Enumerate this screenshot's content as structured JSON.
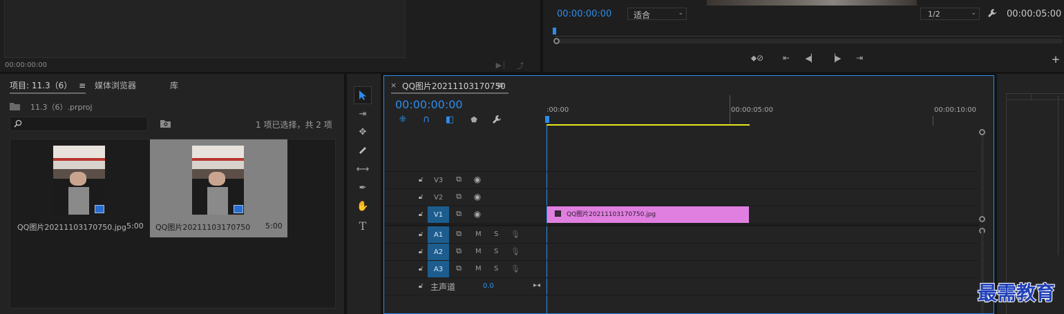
{
  "source_monitor": {
    "timecode": "00:00:00:00"
  },
  "program_monitor": {
    "timecode": "00:00:00:00",
    "fit_label": "适合",
    "resolution": "1/2",
    "duration": "00:00:05:00"
  },
  "project_panel": {
    "tabs": [
      {
        "label": "项目: 11.3（6）"
      },
      {
        "label": "媒体浏览器"
      },
      {
        "label": "库"
      }
    ],
    "file_name": "11.3（6）.prproj",
    "search_placeholder": "",
    "selection_status": "1 项已选择，共 2 项",
    "items": [
      {
        "name": "QQ图片20211103170750.jpg",
        "duration": "5:00"
      },
      {
        "name": "QQ图片20211103170750",
        "duration": "5:00"
      }
    ]
  },
  "timeline": {
    "tab_title": "QQ图片20211103170750",
    "close_label": "×",
    "timecode": "00:00:00:00",
    "ruler_labels": [
      ":00:00",
      "00:00:05:00",
      "00:00:10:00"
    ],
    "video_tracks": [
      {
        "name": "V3"
      },
      {
        "name": "V2"
      },
      {
        "name": "V1"
      }
    ],
    "audio_tracks": [
      {
        "name": "A1",
        "mute": "M",
        "solo": "S"
      },
      {
        "name": "A2",
        "mute": "M",
        "solo": "S"
      },
      {
        "name": "A3",
        "mute": "M",
        "solo": "S"
      }
    ],
    "master": {
      "label": "主声道",
      "value": "0.0"
    },
    "clip": {
      "name": "QQ图片20211103170750.jpg",
      "color": "#e07fe0"
    }
  },
  "watermark": "最需教育",
  "colors": {
    "accent": "#2d8ceb",
    "track_target": "#1d5d8e",
    "work_area": "#e6e61e"
  }
}
